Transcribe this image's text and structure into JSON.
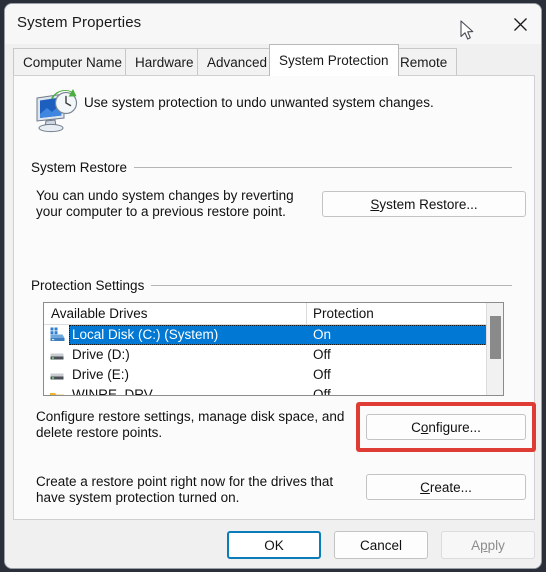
{
  "window": {
    "title": "System Properties",
    "close_icon": "close-icon",
    "cursor_icon": "mouse-pointer-icon"
  },
  "tabs": [
    {
      "label": "Computer Name",
      "selected": false
    },
    {
      "label": "Hardware",
      "selected": false
    },
    {
      "label": "Advanced",
      "selected": false
    },
    {
      "label": "System Protection",
      "selected": true
    },
    {
      "label": "Remote",
      "selected": false
    }
  ],
  "header": {
    "icon": "system-protection-icon",
    "description": "Use system protection to undo unwanted system changes."
  },
  "system_restore": {
    "group_label": "System Restore",
    "description_line1": "You can undo system changes by reverting",
    "description_line2": "your computer to a previous restore point.",
    "button": {
      "prefix": "",
      "accel": "S",
      "suffix": "ystem Restore..."
    }
  },
  "protection_settings": {
    "group_label": "Protection Settings",
    "columns": [
      "Available Drives",
      "Protection"
    ],
    "drives": [
      {
        "name": "Local Disk (C:) (System)",
        "protection": "On",
        "icon": "system-drive-icon",
        "selected": true
      },
      {
        "name": "Drive (D:)",
        "protection": "Off",
        "icon": "hard-drive-icon",
        "selected": false
      },
      {
        "name": "Drive (E:)",
        "protection": "Off",
        "icon": "hard-drive-icon",
        "selected": false
      },
      {
        "name": "WINRE_DRV",
        "protection": "Off",
        "icon": "recovery-drive-icon",
        "selected": false
      }
    ],
    "configure_description_line1": "Configure restore settings, manage disk space, and",
    "configure_description_line2": "delete restore points.",
    "configure_button": {
      "prefix": "C",
      "accel": "o",
      "suffix": "nfigure..."
    },
    "create_description_line1": "Create a restore point right now for the drives that",
    "create_description_line2": "have system protection turned on.",
    "create_button": {
      "prefix": "",
      "accel": "C",
      "suffix": "reate..."
    }
  },
  "annotation": {
    "color": "#e03c36"
  },
  "footer": {
    "ok": {
      "label": "OK",
      "state": "default"
    },
    "cancel": {
      "label": "Cancel",
      "state": "normal"
    },
    "apply": {
      "prefix": "A",
      "accel": "p",
      "suffix": "ply",
      "state": "disabled"
    }
  }
}
